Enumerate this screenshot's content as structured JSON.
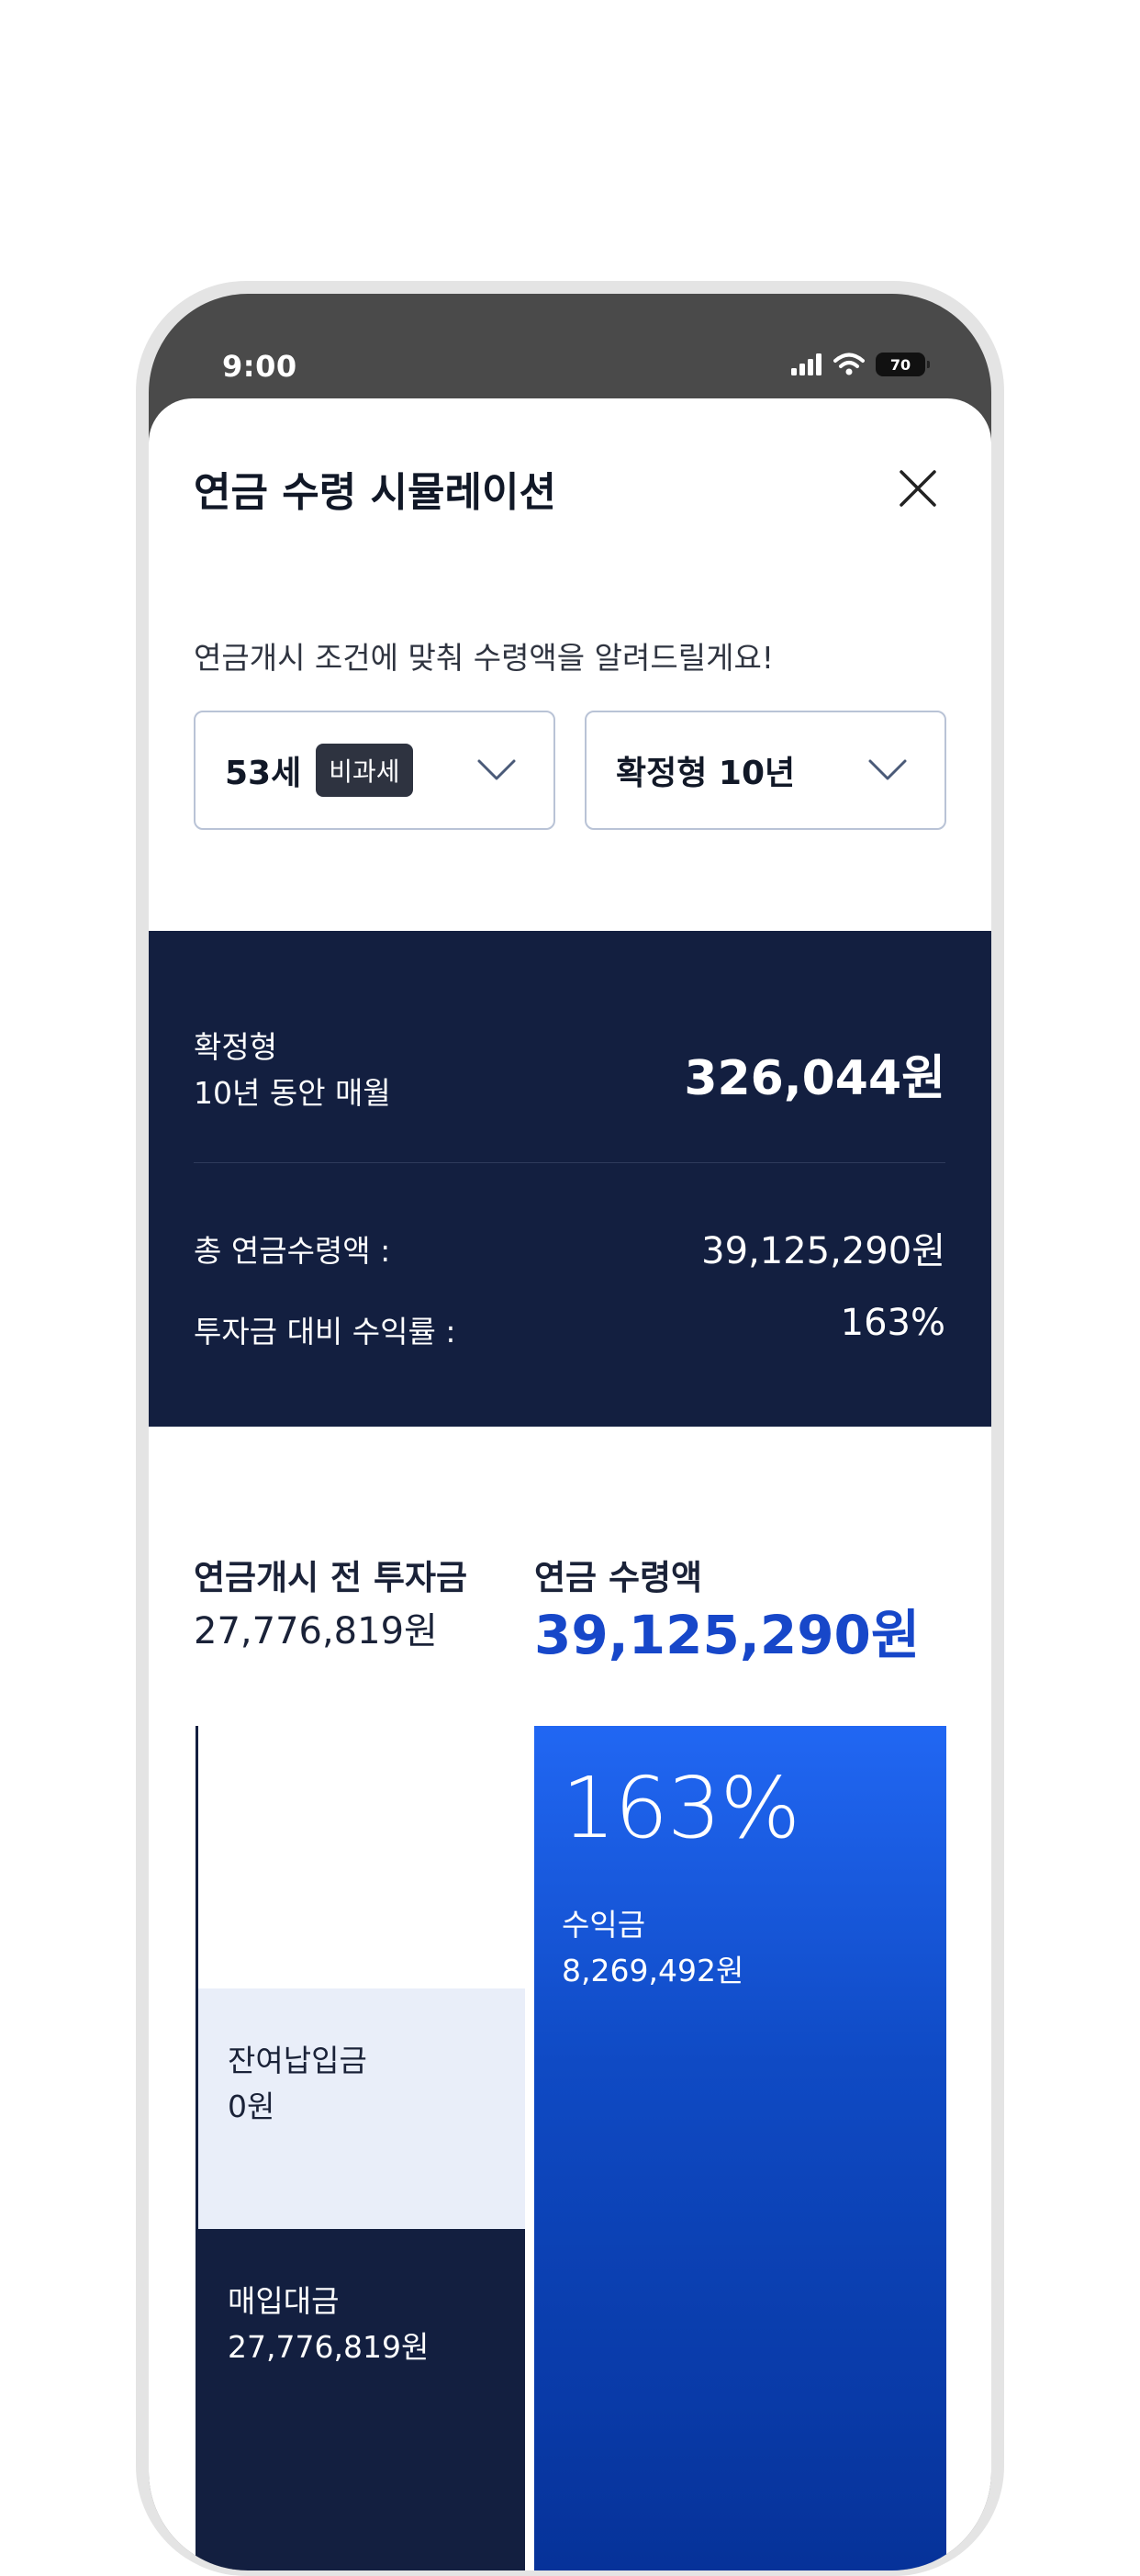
{
  "status_bar": {
    "time": "9:00",
    "battery": "70"
  },
  "sheet": {
    "title": "연금 수령 시뮬레이션",
    "subtitle": "연금개시 조건에 맞춰 수령액을 알려드릴게요!"
  },
  "selectors": {
    "age": "53세",
    "tax_badge": "비과세",
    "payout_type": "확정형 10년"
  },
  "summary": {
    "type": "확정형",
    "period": "10년 동안 매월",
    "monthly_amount": "326,044원",
    "total_label": "총  연금수령액 :",
    "total_value": "39,125,290원",
    "return_label": "투자금 대비 수익률 :",
    "return_value": "163%"
  },
  "comparison": {
    "before_label": "연금개시 전 투자금",
    "before_value": "27,776,819원",
    "after_label": "연금 수령액",
    "after_value": "39,125,290원"
  },
  "chart_data": {
    "type": "bar",
    "categories": [
      "연금개시 전 투자금",
      "연금 수령액"
    ],
    "bars": [
      {
        "category": "연금개시 전 투자금",
        "segments": [
          {
            "name": "매입대금",
            "value": 27776819,
            "label": "27,776,819원",
            "color": "#131f40"
          },
          {
            "name": "잔여납입금",
            "value": 0,
            "label": "0원",
            "color": "#e9eef9"
          }
        ]
      },
      {
        "category": "연금 수령액",
        "segments": [
          {
            "name": "수익금",
            "value": 8269492,
            "label": "8,269,492원",
            "color": "#1747c9"
          }
        ],
        "percent_label": "163%"
      }
    ]
  },
  "colors": {
    "navy": "#131f40",
    "accent_blue": "#1747c9",
    "light_blue": "#e9eef9"
  }
}
